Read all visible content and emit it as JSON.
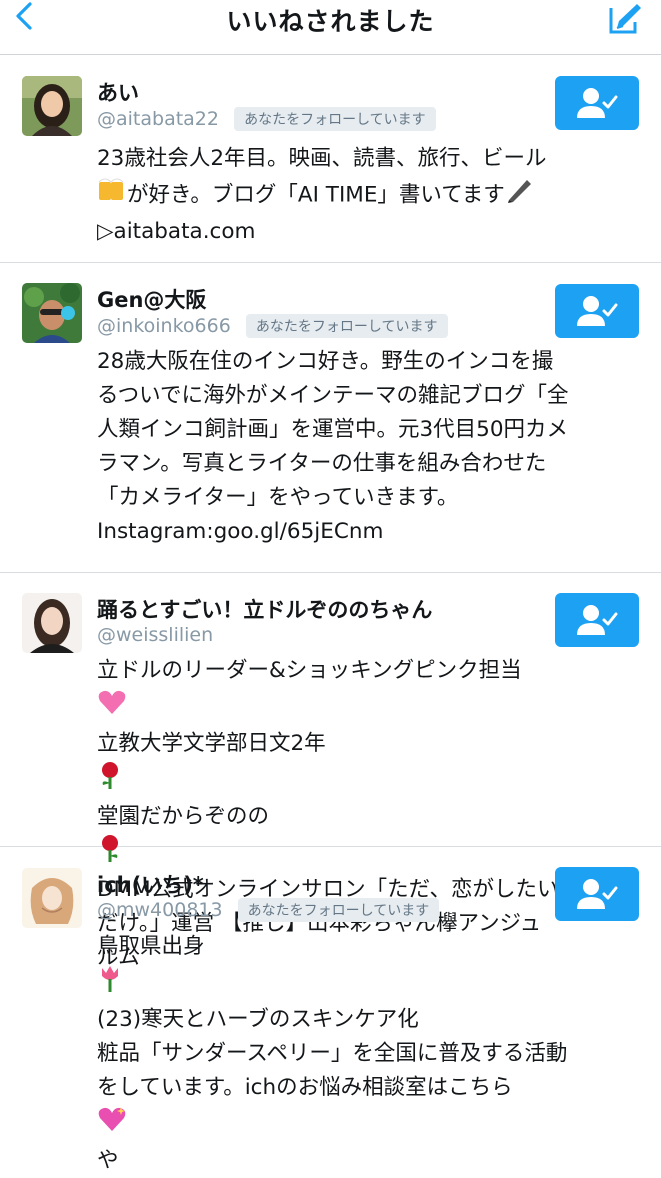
{
  "header": {
    "title": "いいねされました"
  },
  "users": [
    {
      "name": "あい",
      "handle": "@aitabata22",
      "badge": "あなたをフォローしています",
      "bio": [
        "23歳社会人2年目。映画、読書、旅行、ビール",
        "が好き。ブログ「AI TIME」書いてます",
        "▷aitabata.com"
      ]
    },
    {
      "name": "Gen@大阪",
      "handle": "@inkoinko666",
      "badge": "あなたをフォローしています",
      "bio": [
        "28歳大阪在住のインコ好き。野生のインコを撮",
        "るついでに海外がメインテーマの雑記ブログ「全",
        "人類インコ飼計画」を運営中。元3代目50円カメ",
        "ラマン。写真とライターの仕事を組み合わせた",
        "「カメライター」をやっていきます。",
        "Instagram:goo.gl/65jECnm"
      ]
    },
    {
      "name": "踊るとすごい！立ドルぞののちゃん",
      "handle": "@weisslilien",
      "badge": "",
      "bio": [
        "立ドルのリーダー&ショッキングピンク担当",
        "立教大学文学部日文2年",
        "堂園だからぞのの",
        "DMM公式オンラインサロン「ただ、恋がしたい",
        "だけ。」運営 【推し】山本彩ちゃん欅アンジュ",
        "ルム"
      ]
    },
    {
      "name": "ich(いち)*",
      "handle": "@mw400813",
      "badge": "あなたをフォローしています",
      "bio": [
        "鳥取県出身",
        "(23)寒天とハーブのスキンケア化",
        "粧品「サンダースペリー」を全国に普及する活動",
        "をしています。ichのお悩み相談室はこちら",
        "や"
      ]
    }
  ],
  "colors": {
    "accent": "#1da1f2",
    "badge_bg": "#e6ecf0",
    "muted": "#8899a6"
  }
}
